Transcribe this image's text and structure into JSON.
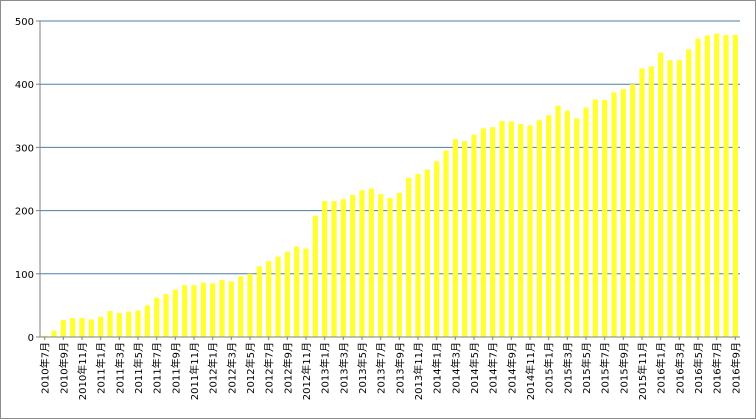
{
  "chart_data": {
    "type": "bar",
    "title": "",
    "xlabel": "",
    "ylabel": "",
    "ylim": [
      0,
      500
    ],
    "yticks": [
      0,
      100,
      200,
      300,
      400,
      500
    ],
    "grid": true,
    "legend": "none",
    "colors": {
      "bar": "#ffff33",
      "grid": "#4d7ea8",
      "axis": "#808080"
    },
    "categories": [
      "2010年7月",
      "2010年8月",
      "2010年9月",
      "2010年10月",
      "2010年11月",
      "2010年12月",
      "2011年1月",
      "2011年2月",
      "2011年3月",
      "2011年4月",
      "2011年5月",
      "2011年6月",
      "2011年7月",
      "2011年8月",
      "2011年9月",
      "2011年10月",
      "2011年11月",
      "2011年12月",
      "2012年1月",
      "2012年2月",
      "2012年3月",
      "2012年4月",
      "2012年5月",
      "2012年6月",
      "2012年7月",
      "2012年8月",
      "2012年9月",
      "2012年10月",
      "2012年11月",
      "2012年12月",
      "2013年1月",
      "2013年2月",
      "2013年3月",
      "2013年4月",
      "2013年5月",
      "2013年6月",
      "2013年7月",
      "2013年8月",
      "2013年9月",
      "2013年10月",
      "2013年11月",
      "2013年12月",
      "2014年1月",
      "2014年2月",
      "2014年3月",
      "2014年4月",
      "2014年5月",
      "2014年6月",
      "2014年7月",
      "2014年8月",
      "2014年9月",
      "2014年10月",
      "2014年11月",
      "2014年12月",
      "2015年1月",
      "2015年2月",
      "2015年3月",
      "2015年4月",
      "2015年5月",
      "2015年6月",
      "2015年7月",
      "2015年8月",
      "2015年9月",
      "2015年10月",
      "2015年11月",
      "2015年12月",
      "2016年1月",
      "2016年2月",
      "2016年3月",
      "2016年4月",
      "2016年5月",
      "2016年6月",
      "2016年7月",
      "2016年8月",
      "2016年9月"
    ],
    "labeled_categories": [
      "2010年7月",
      "2010年9月",
      "2010年11月",
      "2011年1月",
      "2011年3月",
      "2011年5月",
      "2011年7月",
      "2011年9月",
      "2011年11月",
      "2012年1月",
      "2012年3月",
      "2012年5月",
      "2012年7月",
      "2012年9月",
      "2012年11月",
      "2013年1月",
      "2013年3月",
      "2013年5月",
      "2013年7月",
      "2013年9月",
      "2013年11月",
      "2014年1月",
      "2014年3月",
      "2014年5月",
      "2014年7月",
      "2014年9月",
      "2014年11月",
      "2015年1月",
      "2015年3月",
      "2015年5月",
      "2015年7月",
      "2015年9月",
      "2015年11月",
      "2016年1月",
      "2016年3月",
      "2016年5月",
      "2016年7月",
      "2016年9月"
    ],
    "values": [
      2,
      10,
      27,
      30,
      30,
      28,
      32,
      41,
      38,
      40,
      42,
      50,
      62,
      68,
      75,
      82,
      82,
      86,
      85,
      90,
      88,
      96,
      100,
      112,
      120,
      127,
      135,
      143,
      140,
      192,
      215,
      215,
      218,
      225,
      232,
      235,
      226,
      220,
      228,
      252,
      258,
      265,
      278,
      295,
      313,
      310,
      320,
      330,
      332,
      342,
      341,
      337,
      335,
      343,
      351,
      366,
      358,
      346,
      363,
      376,
      375,
      387,
      392,
      400,
      425,
      428,
      450,
      438,
      438,
      455,
      472,
      477,
      480,
      478,
      478
    ]
  }
}
